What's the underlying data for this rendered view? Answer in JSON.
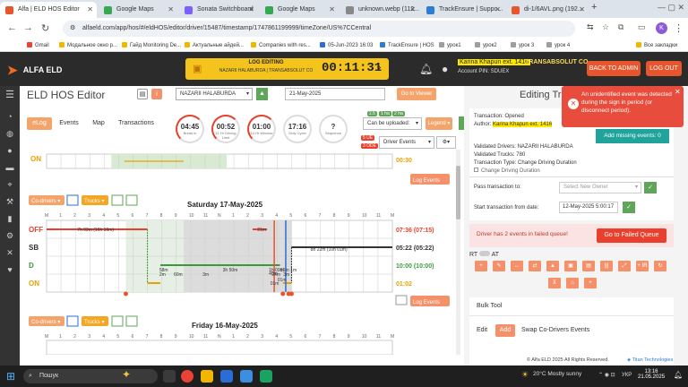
{
  "browser": {
    "tabs": [
      {
        "label": "Alfa | ELD HOS Editor",
        "color": "#e8542c"
      },
      {
        "label": "Google Maps",
        "color": "#34a853"
      },
      {
        "label": "Sonata Switchboard",
        "color": "#7b61ff"
      },
      {
        "label": "Google Maps",
        "color": "#34a853"
      },
      {
        "label": "unknown.webp (112...",
        "color": "#888888"
      },
      {
        "label": "TrackEnsure | Suppo...",
        "color": "#2f7dd1"
      },
      {
        "label": "di-1/6AVL.png (192...",
        "color": "#e8542c"
      }
    ],
    "url": "alfaeld.com/app/hos/#/eldHOS/editor/driver/15487/timestamp/1747861199999/timeZone/US%7CCentral",
    "bookmarks": [
      "Gmail",
      "Модальное окно р...",
      "Гайд Monitoring De...",
      "Актуальные айдей...",
      "Companies with res...",
      "05-Jun-2023 16:03",
      "TrackEnsure | HOS",
      "урок1",
      "урок2",
      "урок 3",
      "урок 4",
      "Все закладки"
    ]
  },
  "header": {
    "logo": "ALFA ELD",
    "log_editing": "LOG EDITING",
    "log_editing_sub": "NAZARII HALABURDA | TRANSABSOLUT CO",
    "timer": "00:11:31",
    "driver_highlight": "Karina Khapun ext. 1416",
    "company": "TRANSABSOLUT CO",
    "account_pin": "Account PIN: SDUEX",
    "back_to_admin": "BACK TO ADMIN",
    "log_out": "LOG OUT"
  },
  "editor": {
    "title": "ELD HOS Editor",
    "driver": "NAZARII HALABURDA",
    "date": "21-May-2025",
    "go_to_viewer": "Go to Viewer",
    "tabs": [
      "eLog",
      "Events",
      "Map",
      "Transactions"
    ],
    "gauges": [
      {
        "value": "04:45",
        "label": "Break in"
      },
      {
        "value": "00:52",
        "label": "11 Hr Driving Limit"
      },
      {
        "value": "01:00",
        "label": "14 Hr Window"
      },
      {
        "value": "17:16",
        "label": "Duty Cycle"
      },
      {
        "value": "?",
        "label": "Sequence"
      }
    ],
    "can_be_uploaded": "Can be uploaded:",
    "legend": "Legend",
    "badges": [
      "2.5",
      "1 ha",
      "2 ha"
    ],
    "unidentified": "5 UE",
    "ode": "3 ODE",
    "driver_events": "Driver Events",
    "log_events": "Log Events",
    "codrivers": "Co-drivers",
    "trucks": "Trucks",
    "hours": [
      "M",
      "1",
      "2",
      "3",
      "4",
      "5",
      "6",
      "7",
      "8",
      "9",
      "10",
      "11",
      "N",
      "1",
      "2",
      "3",
      "4",
      "5",
      "6",
      "7",
      "8",
      "9",
      "10",
      "11",
      "M"
    ],
    "top_on_total": "00:30",
    "days": [
      {
        "title": "Saturday 17-May-2025",
        "rows": [
          {
            "label": "OFF",
            "total": "07:36 (07:15)",
            "color": "#e8402c"
          },
          {
            "label": "SB",
            "total": "05:22 (05:22)",
            "color": "#333333"
          },
          {
            "label": "D",
            "total": "10:00 (10:00)",
            "color": "#3a9a3a"
          },
          {
            "label": "ON",
            "total": "01:02",
            "color": "#e8a000"
          }
        ],
        "segment_labels": [
          "7h 03m (16h 10m)",
          "21m",
          "8h 22m (10h 01m)",
          "58m",
          "3h 50m",
          "1h 09m",
          "55m",
          "1m",
          "2m",
          "60m",
          "3m",
          "24m",
          "40m",
          "01m",
          "3m",
          "01m"
        ]
      },
      {
        "title": "Friday 16-May-2025"
      }
    ]
  },
  "transaction": {
    "title": "Editing Tr",
    "status": "Transaction: Opened",
    "author_label": "Author:",
    "author": "Karina Khapun ext. 1416",
    "add_missing": "Add missing events: 0",
    "validated_drivers": "Validated Drivers: NAZARII HALABURDA",
    "validated_trucks": "Validated Trucks: 780",
    "transaction_type": "Transaction Type: Change Driving Duration",
    "type_checkbox": "Change Driving Duration",
    "pass_to": "Pass transaction to:",
    "select_owner": "Select New Owner",
    "start_from": "Start transaction from date:",
    "start_date": "12-May-2025 5:00:17",
    "failed_text": "Driver has 2 events in failed queue!",
    "go_failed": "Go to Failed Queue",
    "rt": "RT",
    "at": "AT",
    "bulk_tool": "Bulk Tool",
    "bulk_tabs": [
      "Edit",
      "Add",
      "Swap Co-Drivers Events"
    ],
    "tool_icons": [
      "+",
      "✎",
      "↔",
      "⇄",
      "▲",
      "▣",
      "▤",
      "|||",
      "⤢",
      "+ IR",
      "↻",
      "⊼",
      "⌂",
      "+"
    ]
  },
  "alert": {
    "text": "An unidentified event was detected during the sign in period (or disconnect period)."
  },
  "footer": {
    "copyright": "© Alfa ELD 2025 All Rights Reserved.",
    "brand": "Titan Technologies"
  },
  "taskbar": {
    "search": "Пошук",
    "weather": "20°C  Mostly sunny",
    "lang": "УКР",
    "time": "13:16",
    "date": "21.05.2025"
  }
}
